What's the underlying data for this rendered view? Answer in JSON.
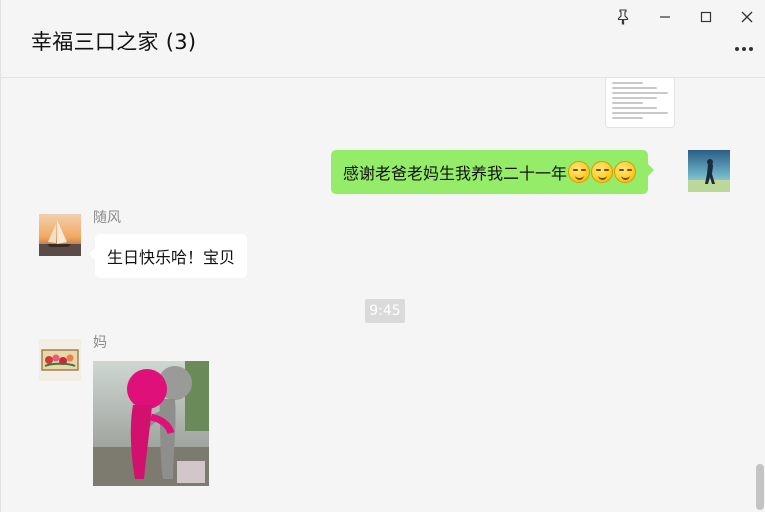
{
  "window": {
    "title": "幸福三口之家 (3)",
    "controls": {
      "pin": "pin-icon",
      "minimize": "minimize-icon",
      "maximize": "maximize-icon",
      "close": "close-icon",
      "more": "more-icon"
    }
  },
  "messages": [
    {
      "type": "file",
      "from": "me",
      "icon": "document-thumbnail"
    },
    {
      "type": "text",
      "from": "me",
      "text": "感谢老爸老妈生我养我二十一年",
      "emoji_count": 3,
      "emoji": "smirk-emoji"
    },
    {
      "type": "text",
      "from": "随风",
      "sender": "随风",
      "text": "生日快乐哈！宝贝"
    },
    {
      "type": "time",
      "text": "9:45"
    },
    {
      "type": "image",
      "from": "妈",
      "sender": "妈",
      "icon": "crochet-dolls-photo"
    }
  ],
  "colors": {
    "my_bubble": "#95ec69",
    "other_bubble": "#ffffff",
    "background": "#f5f5f5"
  }
}
